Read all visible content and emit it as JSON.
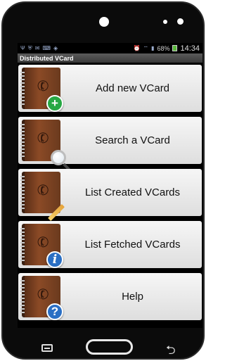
{
  "status_bar": {
    "battery_percent": "68%",
    "time": "14:34",
    "left_icons": [
      "usb-icon",
      "shield-icon",
      "email-icon",
      "keyboard-icon",
      "security-icon"
    ],
    "right_icons": [
      "alarm-icon",
      "wifi-icon",
      "signal-icon",
      "battery-icon"
    ]
  },
  "app": {
    "title": "Distributed VCard"
  },
  "menu": {
    "items": [
      {
        "label": "Add new VCard",
        "icon": "add-badge-icon"
      },
      {
        "label": "Search a VCard",
        "icon": "magnifier-icon"
      },
      {
        "label": "List Created VCards",
        "icon": "pencil-icon"
      },
      {
        "label": "List Fetched VCards",
        "icon": "info-badge-icon"
      },
      {
        "label": "Help",
        "icon": "help-badge-icon"
      }
    ]
  },
  "nav_bar": {
    "icons": [
      "menu-icon",
      "home-icon",
      "back-icon"
    ]
  },
  "colors": {
    "title_bar": "#4a4a4a",
    "add_badge": "#27a844",
    "info_badge": "#2a6fc4",
    "item_bg": "#e8e8e8"
  }
}
